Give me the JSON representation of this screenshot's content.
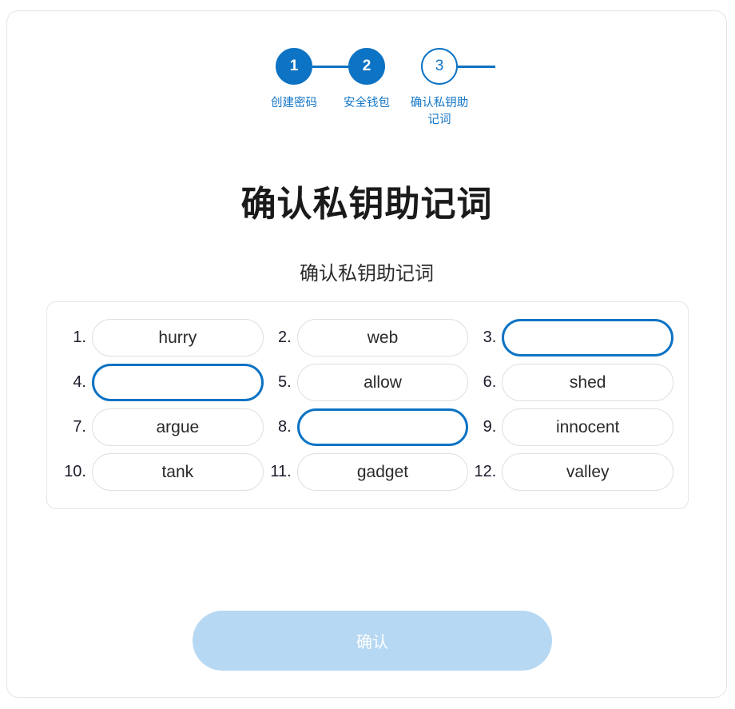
{
  "stepper": {
    "steps": [
      {
        "number": "1",
        "label": "创建密码",
        "state": "done"
      },
      {
        "number": "2",
        "label": "安全钱包",
        "state": "done"
      },
      {
        "number": "3",
        "label": "确认私钥助记词",
        "state": "todo"
      }
    ],
    "accent_color": "#0d73c4",
    "label_color": "#1476c6"
  },
  "header": {
    "title": "确认私钥助记词",
    "subtitle": "确认私钥助记词"
  },
  "mnemonic": {
    "slots": [
      {
        "index": "1.",
        "word": "hurry",
        "state": "filled"
      },
      {
        "index": "2.",
        "word": "web",
        "state": "filled"
      },
      {
        "index": "3.",
        "word": "",
        "state": "blank"
      },
      {
        "index": "4.",
        "word": "",
        "state": "blank"
      },
      {
        "index": "5.",
        "word": "allow",
        "state": "filled"
      },
      {
        "index": "6.",
        "word": "shed",
        "state": "filled"
      },
      {
        "index": "7.",
        "word": "argue",
        "state": "filled"
      },
      {
        "index": "8.",
        "word": "",
        "state": "blank"
      },
      {
        "index": "9.",
        "word": "innocent",
        "state": "filled"
      },
      {
        "index": "10.",
        "word": "tank",
        "state": "filled"
      },
      {
        "index": "11.",
        "word": "gadget",
        "state": "filled"
      },
      {
        "index": "12.",
        "word": "valley",
        "state": "filled"
      }
    ],
    "blank_border_color": "#0d73c4",
    "filled_border_color": "#dcdfe3"
  },
  "footer": {
    "confirm_label": "确认",
    "confirm_enabled": false,
    "confirm_disabled_color": "#b6d8f2"
  }
}
